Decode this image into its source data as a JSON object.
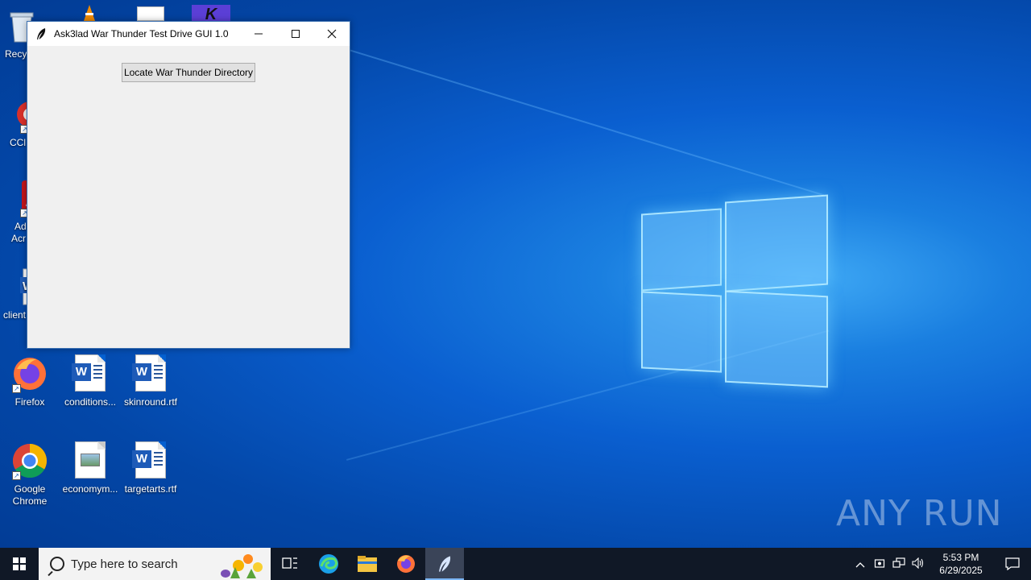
{
  "desktop": {
    "icons": [
      {
        "label": "Recy",
        "kind": "recycle-bin"
      },
      {
        "label": "CCl",
        "kind": "ccleaner"
      },
      {
        "label": "Ad",
        "label2": "Acr",
        "kind": "adobe-acrobat"
      },
      {
        "label": "client",
        "kind": "word-doc"
      },
      {
        "label": "Firefox",
        "kind": "firefox"
      },
      {
        "label": "conditions...",
        "kind": "word-doc"
      },
      {
        "label": "skinround.rtf",
        "kind": "word-doc"
      },
      {
        "label": "Google",
        "label2": "Chrome",
        "kind": "chrome"
      },
      {
        "label": "economym...",
        "kind": "image-file"
      },
      {
        "label": "targetarts.rtf",
        "kind": "word-doc"
      }
    ],
    "watermark": "ANY RUN"
  },
  "window": {
    "title": "Ask3lad War Thunder Test Drive GUI 1.0",
    "minimize_icon": "minimize-icon",
    "maximize_icon": "maximize-icon",
    "close_icon": "close-icon",
    "locate_button": "Locate War Thunder Directory"
  },
  "taskbar": {
    "search_placeholder": "Type here to search",
    "apps": [
      "task-view-icon",
      "edge-icon",
      "file-explorer-icon",
      "firefox-icon",
      "feather-app-icon"
    ],
    "tray": {
      "time": "5:53 PM",
      "date": "6/29/2025"
    }
  },
  "colors": {
    "taskbar": "#101826",
    "window_bg": "#f0f0f0",
    "desktop_accent": "#0a5fd0"
  }
}
